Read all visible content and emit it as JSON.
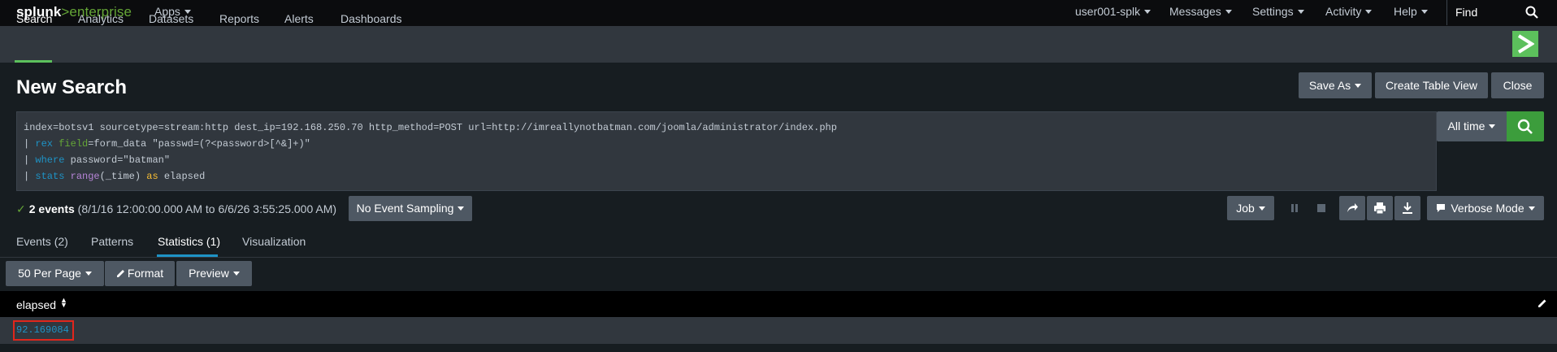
{
  "topbar": {
    "logo_brand": "splunk",
    "logo_gt": ">",
    "logo_product": "enterprise",
    "apps": "Apps",
    "user": "user001-splk",
    "messages": "Messages",
    "settings": "Settings",
    "activity": "Activity",
    "help": "Help",
    "find_placeholder": "Find"
  },
  "appbar": {
    "tabs": [
      "Search",
      "Analytics",
      "Datasets",
      "Reports",
      "Alerts",
      "Dashboards"
    ]
  },
  "page": {
    "title": "New Search",
    "save_as": "Save As",
    "create_table_view": "Create Table View",
    "close": "Close"
  },
  "query": {
    "line1": "index=botsv1 sourcetype=stream:http dest_ip=192.168.250.70 http_method=POST url=http://imreallynotbatman.com/joomla/administrator/index.php",
    "line2_pipe": "| ",
    "line2_cmd": "rex",
    "line2_arg": "field",
    "line2_rest": "=form_data \"passwd=(?<password>[^&]+)\"",
    "line3_pipe": "| ",
    "line3_cmd": "where",
    "line3_rest": " password=\"batman\"",
    "line4_pipe": "| ",
    "line4_cmd": "stats",
    "line4_fn": "range",
    "line4_mid": "(_time) ",
    "line4_as": "as",
    "line4_rest": " elapsed"
  },
  "time_range": "All time",
  "status": {
    "check": "✓",
    "events": "2 events",
    "range": "(8/1/16 12:00:00.000 AM to 6/6/26 3:55:25.000 AM)",
    "sampling": "No Event Sampling"
  },
  "job": {
    "job_label": "Job",
    "mode": "Verbose Mode"
  },
  "tabs": [
    "Events (2)",
    "Patterns",
    "Statistics (1)",
    "Visualization"
  ],
  "results_toolbar": {
    "per_page": "50 Per Page",
    "format": "Format",
    "preview": "Preview"
  },
  "table": {
    "column": "elapsed",
    "rows": [
      "92.169084"
    ]
  },
  "colors": {
    "accent_green": "#5cc05c",
    "search_green": "#3c9d3c",
    "link_blue": "#1e93c6",
    "highlight_red": "#e1261c"
  }
}
